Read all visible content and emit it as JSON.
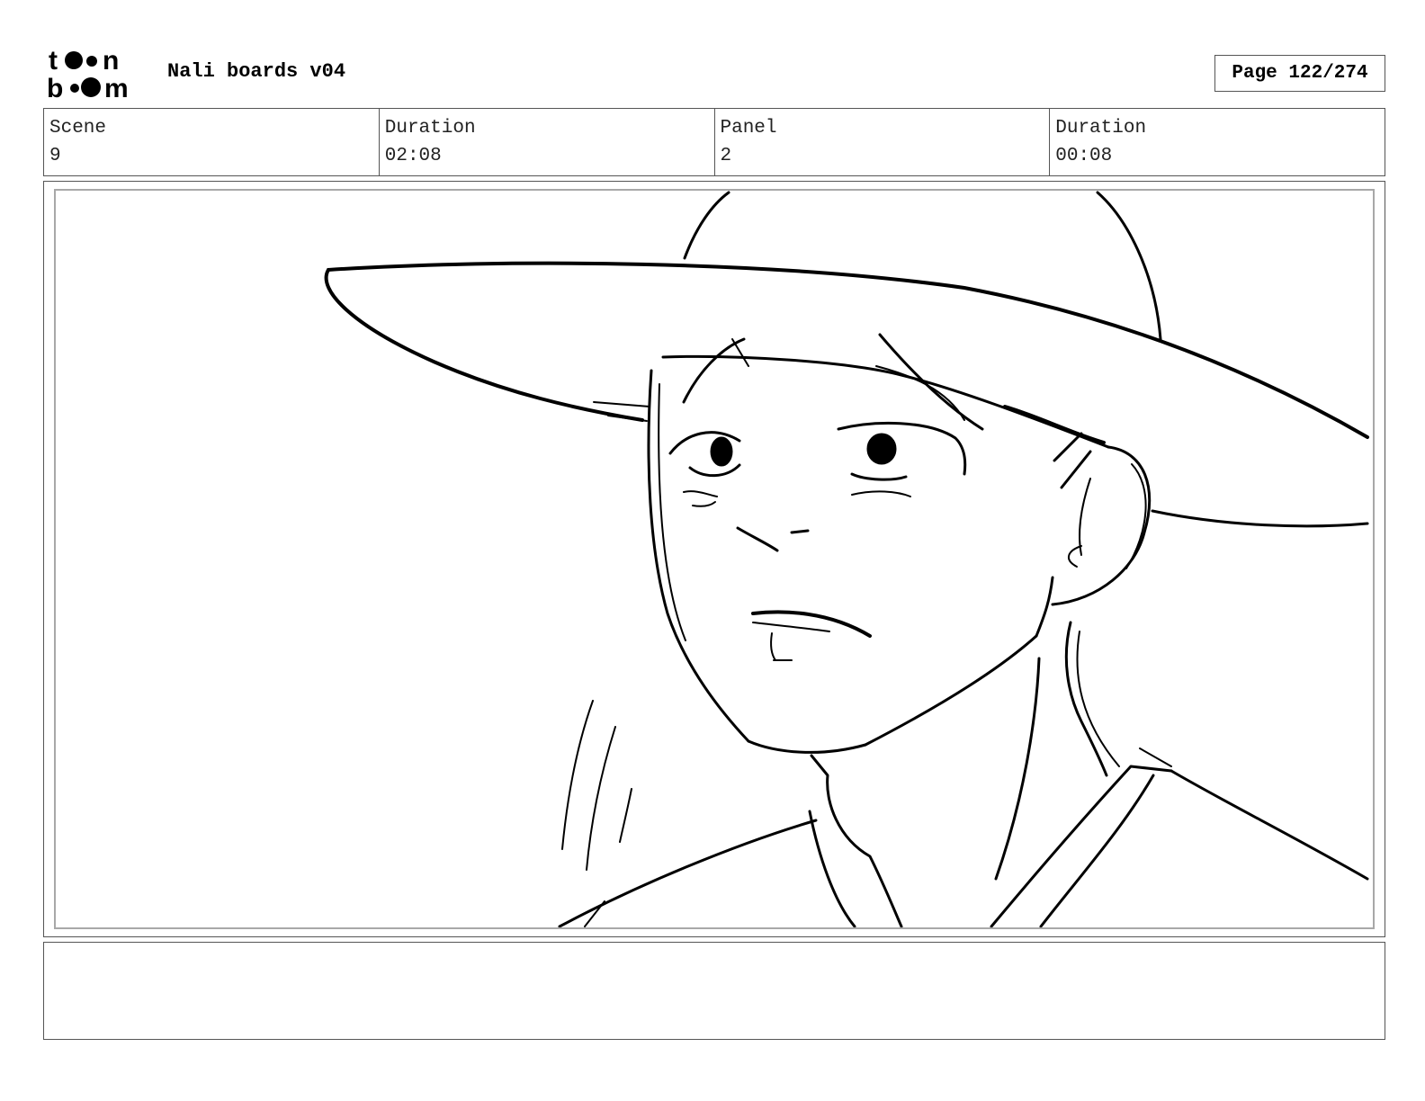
{
  "header": {
    "logo": {
      "icon": "toon-boom-logo",
      "line1": "toon",
      "line2": "boom"
    },
    "title": "Nali boards v04",
    "page_label": "Page 122/274"
  },
  "info": {
    "scene_label": "Scene",
    "scene_value": "9",
    "scene_duration_label": "Duration",
    "scene_duration_value": "02:08",
    "panel_label": "Panel",
    "panel_value": "2",
    "panel_duration_label": "Duration",
    "panel_duration_value": "00:08"
  },
  "panel": {
    "image": "sketch-drawing-character-in-wide-brim-hat"
  },
  "notes": {
    "text": ""
  },
  "colors": {
    "ink": "#000000",
    "frame_border": "#555555",
    "inner_border": "#a8a8a8"
  }
}
